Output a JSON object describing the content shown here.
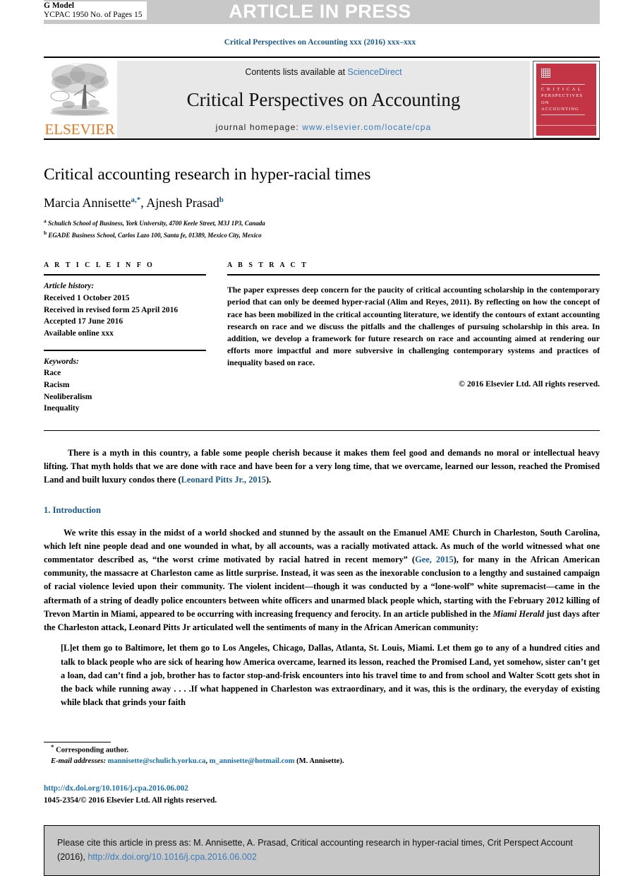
{
  "banner": {
    "g_model_line1": "G Model",
    "g_model_line2": "YCPAC 1950 No. of Pages 15",
    "article_in_press": "ARTICLE IN PRESS"
  },
  "running_head": "Critical Perspectives on Accounting xxx (2016) xxx–xxx",
  "masthead": {
    "publisher_logo_text": "ELSEVIER",
    "contents_prefix": "Contents lists available at ",
    "contents_link": "ScienceDirect",
    "journal_name": "Critical Perspectives on Accounting",
    "homepage_prefix": "journal homepage: ",
    "homepage_url": "www.elsevier.com/locate/cpa",
    "cover_title_lines": [
      "C R I T I C A L",
      "PERSPECTIVES",
      "ON ACCOUNTING"
    ]
  },
  "article": {
    "title": "Critical accounting research in hyper-racial times",
    "authors_html": "Marcia Annisette<sup>a,*</sup>, Ajnesh Prasad<sup>b</sup>",
    "affiliations": [
      {
        "marker": "a",
        "text": "Schulich School of Business, York University, 4700 Keele Street, M3J 1P3, Canada"
      },
      {
        "marker": "b",
        "text": "EGADE Business School, Carlos Lazo 100, Santa fe, 01389, Mexico City, Mexico"
      }
    ]
  },
  "info": {
    "heading": "A R T I C L E   I N F O",
    "history_label": "Article history:",
    "history": [
      "Received 1 October 2015",
      "Received in revised form 25 April 2016",
      "Accepted 17 June 2016",
      "Available online xxx"
    ],
    "keywords_label": "Keywords:",
    "keywords": [
      "Race",
      "Racism",
      "Neoliberalism",
      "Inequality"
    ]
  },
  "abstract": {
    "heading": "A B S T R A C T",
    "text": "The paper expresses deep concern for the paucity of critical accounting scholarship in the contemporary period that can only be deemed hyper-racial (Alim and Reyes, 2011). By reflecting on how the concept of race has been mobilized in the critical accounting literature, we identify the contours of extant accounting research on race and we discuss the pitfalls and the challenges of pursuing scholarship in this area. In addition, we develop a framework for future research on race and accounting aimed at rendering our efforts more impactful and more subversive in challenging contemporary systems and practices of inequality based on race.",
    "copyright": "© 2016 Elsevier Ltd. All rights reserved."
  },
  "body": {
    "epigraph_part1": "There is a myth in this country, a fable some people cherish because it makes them feel good and demands no moral or intellectual heavy lifting. That myth holds that we are done with race and have been for a very long time, that we overcame, learned our lesson, reached the Promised Land and built luxury condos there (",
    "epigraph_citation": "Leonard Pitts Jr., 2015",
    "epigraph_part2": ").",
    "section_heading": "1. Introduction",
    "p1_a": "We write this essay in the midst of a world shocked and stunned by the assault on the Emanuel AME Church in Charleston, South Carolina, which left nine people dead and one wounded in what, by all accounts, was a racially motivated attack. As much of the world witnessed what one commentator described as, “the worst crime motivated by racial hatred in recent memory” (",
    "p1_cite": "Gee, 2015",
    "p1_b": "), for many in the African American community, the massacre at Charleston came as little surprise. Instead, it was seen as the inexorable conclusion to a lengthy and sustained campaign of racial violence levied upon their community. The violent incident—though it was conducted by a “lone-wolf” white supremacist—came in the aftermath of a string of deadly police encounters between white officers and unarmed black people which, starting with the February 2012 killing of Trevon Martin in Miami, appeared to be occurring with increasing frequency and ferocity. In an article published in the ",
    "p1_italic": "Miami Herald",
    "p1_c": " just days after the Charleston attack, Leonard Pitts Jr articulated well the sentiments of many in the African American community:",
    "blockquote": "[L]et them go to Baltimore, let them go to Los Angeles, Chicago, Dallas, Atlanta, St. Louis, Miami. Let them go to any of a hundred cities and talk to black people who are sick of hearing how America overcame, learned its lesson, reached the Promised Land, yet somehow, sister can’t get a loan, dad can’t find a job, brother has to factor stop-and-frisk encounters into his travel time to and from school and Walter Scott gets shot in the back while running away . . . .If what happened in Charleston was extraordinary, and it was, this is the ordinary, the everyday of existing while black that grinds your faith"
  },
  "footer": {
    "corresponding_marker": "*",
    "corresponding_text": "Corresponding author.",
    "email_label": "E-mail addresses:",
    "email1": "mannisette@schulich.yorku.ca",
    "email_sep": ", ",
    "email2": "m_annisette@hotmail.com",
    "email_suffix": " (M. Annisette).",
    "doi_url": "http://dx.doi.org/10.1016/j.cpa.2016.06.002",
    "issn_line": "1045-2354/© 2016 Elsevier Ltd. All rights reserved."
  },
  "citation_box": {
    "text_before": "Please cite this article in press as: M. Annisette, A. Prasad, Critical accounting research in hyper-racial times, Crit Perspect Account (2016), ",
    "doi": "http://dx.doi.org/10.1016/j.cpa.2016.06.002"
  },
  "colors": {
    "link_blue": "#3a7cb8",
    "cite_blue": "#1a5a8e",
    "elsevier_orange": "#e87722",
    "cover_red": "#c33545",
    "banner_gray": "#c8c8c8"
  }
}
